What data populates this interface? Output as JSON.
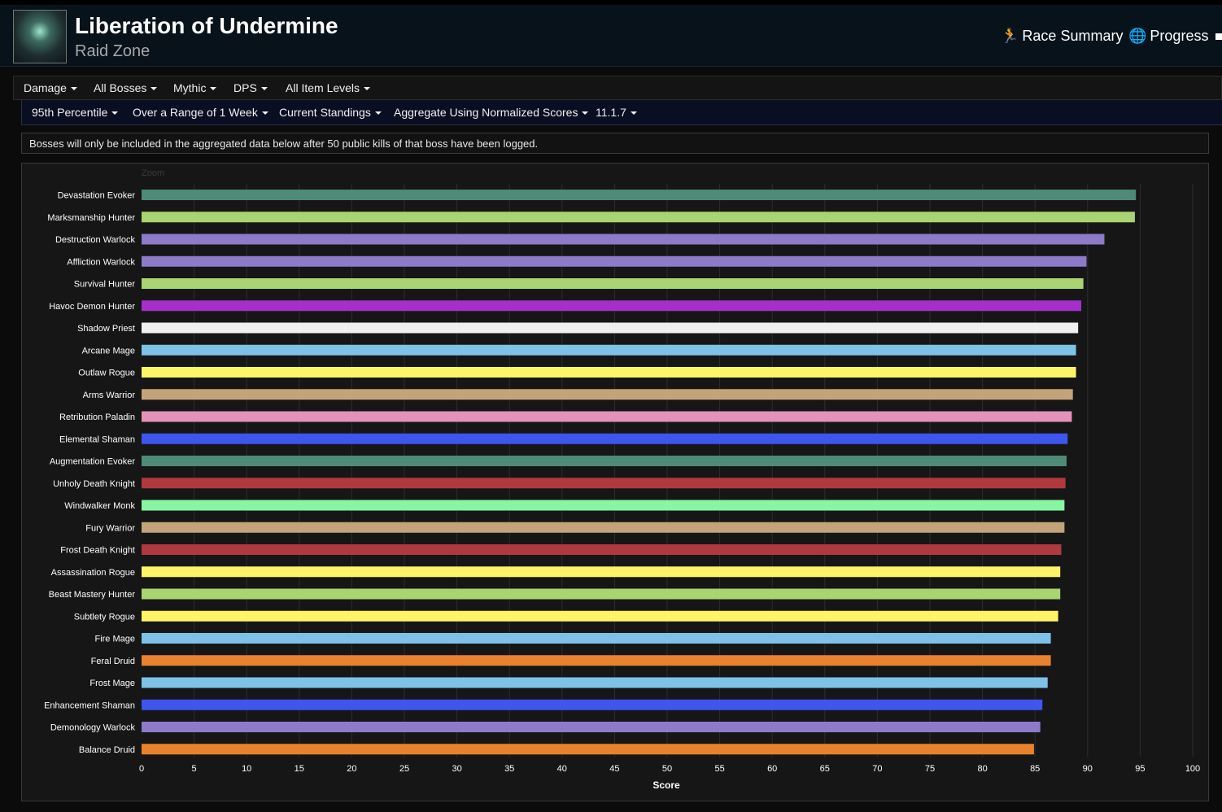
{
  "header": {
    "title": "Liberation of Undermine",
    "subtitle": "Raid Zone",
    "links": [
      {
        "label": "Race Summary",
        "icon": "runner-icon"
      },
      {
        "label": "Progress",
        "icon": "globe-icon"
      }
    ]
  },
  "filters_row1": [
    {
      "label": "Damage"
    },
    {
      "label": "All Bosses"
    },
    {
      "label": "Mythic"
    },
    {
      "label": "DPS"
    },
    {
      "label": "All Item Levels"
    }
  ],
  "filters_row2": [
    {
      "label": "95th Percentile"
    },
    {
      "label": "Over a Range of 1 Week"
    },
    {
      "label": "Current Standings"
    },
    {
      "label": "Aggregate Using Normalized Scores"
    },
    {
      "label": "11.1.7"
    }
  ],
  "notice": "Bosses will only be included in the aggregated data below after 50 public kills of that boss have been logged.",
  "chart_data": {
    "type": "bar",
    "orientation": "horizontal",
    "zoom_label": "Zoom",
    "xlabel": "Score",
    "xlim": [
      0,
      100
    ],
    "x_ticks": [
      "0",
      "5",
      "10",
      "15",
      "20",
      "25",
      "30",
      "35",
      "40",
      "45",
      "50",
      "55",
      "60",
      "65",
      "70",
      "75",
      "80",
      "85",
      "90",
      "95",
      "100"
    ],
    "grid": true,
    "categories": [
      "Devastation Evoker",
      "Marksmanship Hunter",
      "Destruction Warlock",
      "Affliction Warlock",
      "Survival Hunter",
      "Havoc Demon Hunter",
      "Shadow Priest",
      "Arcane Mage",
      "Outlaw Rogue",
      "Arms Warrior",
      "Retribution Paladin",
      "Elemental Shaman",
      "Augmentation Evoker",
      "Unholy Death Knight",
      "Windwalker Monk",
      "Fury Warrior",
      "Frost Death Knight",
      "Assassination Rogue",
      "Beast Mastery Hunter",
      "Subtlety Rogue",
      "Fire Mage",
      "Feral Druid",
      "Frost Mage",
      "Enhancement Shaman",
      "Demonology Warlock",
      "Balance Druid"
    ],
    "values": [
      94.6,
      94.5,
      91.6,
      89.9,
      89.6,
      89.4,
      89.1,
      88.9,
      88.9,
      88.6,
      88.5,
      88.1,
      88.0,
      87.9,
      87.8,
      87.8,
      87.5,
      87.4,
      87.4,
      87.2,
      86.5,
      86.5,
      86.2,
      85.7,
      85.5,
      84.9
    ],
    "colors": [
      "#4f8a78",
      "#aad372",
      "#8d7ac9",
      "#8d7ac9",
      "#aad372",
      "#a330c9",
      "#f0f0f0",
      "#7ec2e8",
      "#fff468",
      "#c4a37a",
      "#e392b8",
      "#3e55ee",
      "#4f8a78",
      "#b0393f",
      "#88f5a2",
      "#c4a37a",
      "#b0393f",
      "#fff468",
      "#aad372",
      "#fff468",
      "#7ec2e8",
      "#e9822e",
      "#7ec2e8",
      "#3e55ee",
      "#8d7ac9",
      "#e9822e"
    ]
  }
}
